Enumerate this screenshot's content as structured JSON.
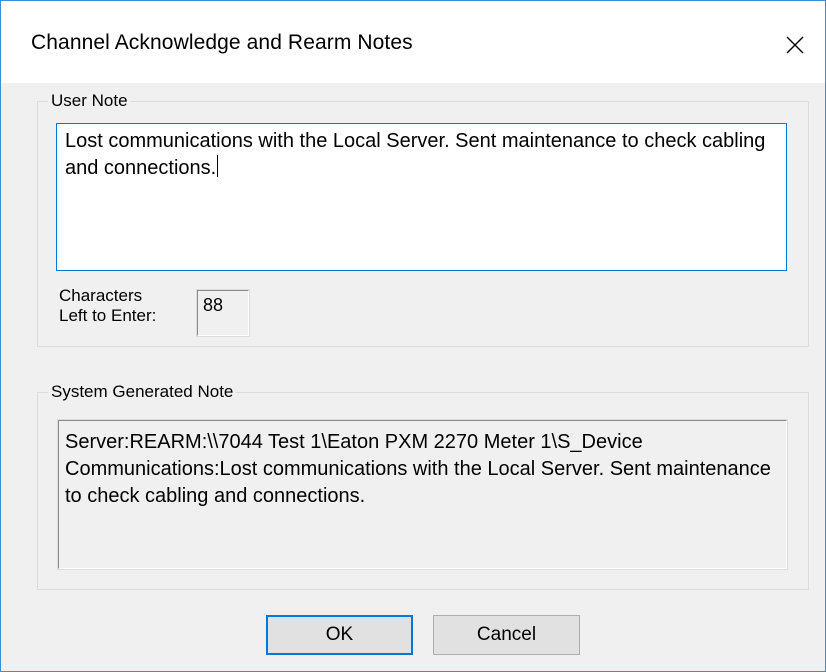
{
  "window": {
    "title": "Channel Acknowledge and Rearm Notes",
    "close_icon": "close-icon"
  },
  "user_note": {
    "group_label": "User Note",
    "text": "Lost communications with the Local Server. Sent maintenance to check cabling and connections.",
    "chars_left_label_line1": "Characters",
    "chars_left_label_line2": "Left to Enter:",
    "chars_left_value": "88"
  },
  "system_note": {
    "group_label": "System Generated Note",
    "text": "Server:REARM:\\\\7044 Test 1\\Eaton PXM 2270 Meter 1\\S_Device Communications:Lost communications with the Local Server. Sent maintenance to check cabling and connections."
  },
  "buttons": {
    "ok_label": "OK",
    "cancel_label": "Cancel"
  },
  "colors": {
    "accent": "#0078d7",
    "dialog_background": "#f0f0f0",
    "titlebar_background": "#ffffff"
  }
}
